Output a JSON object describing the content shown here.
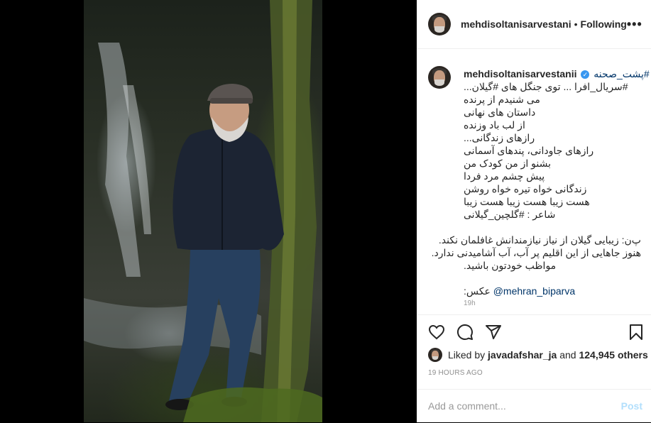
{
  "post": {
    "username": "mehdisoltanisarvestani",
    "follow_status": "Following",
    "more_label": "•••"
  },
  "caption": {
    "username": "mehdisoltanisarvestanii",
    "line1": "#پشت_صحنه",
    "line2": "#سریال_افرا ... توی جنگل های #گیلان...",
    "line3": "می شنیدم از پرنده",
    "line4": "داستان های نهانی",
    "line5": "از لب باد وزنده",
    "line6": "رازهای زندگانی...",
    "line7": "رازهای جاودانی، پندهای آسمانی",
    "line8": "بشنو از من کودک من",
    "line9": "پیش چشم مرد فردا",
    "line10": "زندگانی خواه تیره خواه روشن",
    "line11": "هست زیبا هست زیبا هست زیبا",
    "line12": "شاعر : #گلچین_گیلانی",
    "line13": "پ‌ن: زیبایی گیلان از نیاز نیازمندانش غافلمان نکند.",
    "line14": "هنوز جاهایی از این اقلیم پر آب، آب آشامیدنی ندارد.",
    "line15": "مواظب خودتون باشید.",
    "photo_label": "عکس:",
    "photo_mention": "@mehran_biparva",
    "cut_time": "19h"
  },
  "likes": {
    "prefix": "Liked by",
    "user": "javadafshar_ja",
    "middle": "and",
    "count": "124,945 others"
  },
  "timestamp": "19 HOURS AGO",
  "comment": {
    "placeholder": "Add a comment...",
    "post_label": "Post"
  },
  "icons": [
    "heart-icon",
    "comment-icon",
    "share-icon",
    "bookmark-icon",
    "verified-icon",
    "more-icon"
  ],
  "colors": {
    "link": "#003569",
    "verified": "#3897f0",
    "post_disabled": "#b2dffc",
    "muted": "#8e8e8e"
  }
}
